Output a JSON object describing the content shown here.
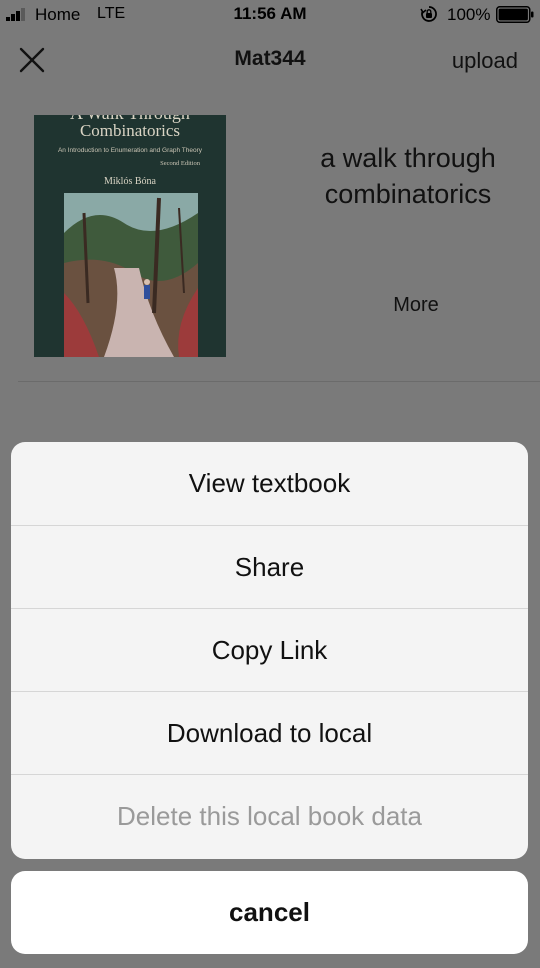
{
  "status_bar": {
    "carrier": "Home",
    "network": "LTE",
    "time": "11:56 AM",
    "battery_percent": "100%",
    "signal_icon": "cell-signal-icon",
    "rotation_icon": "rotation-lock-icon",
    "battery_icon": "battery-full-icon"
  },
  "nav": {
    "title": "Mat344",
    "upload_label": "upload",
    "close_icon": "close-icon"
  },
  "book": {
    "title": "a walk through combinatorics",
    "more_label": "More",
    "cover": {
      "title_top": "A Walk Through",
      "title_main": "Combinatorics",
      "subtitle": "An Introduction to Enumeration and Graph Theory",
      "edition": "Second Edition",
      "author": "Miklós Bóna"
    }
  },
  "action_sheet": {
    "items": [
      {
        "label": "View textbook",
        "enabled": true
      },
      {
        "label": "Share",
        "enabled": true
      },
      {
        "label": "Copy Link",
        "enabled": true
      },
      {
        "label": "Download to local",
        "enabled": true
      },
      {
        "label": "Delete this local book data",
        "enabled": false
      }
    ],
    "cancel_label": "cancel"
  },
  "colors": {
    "dimmed_background": "#7a7a7a",
    "sheet_background": "#f4f4f4",
    "disabled_text": "#9a9a9a"
  }
}
